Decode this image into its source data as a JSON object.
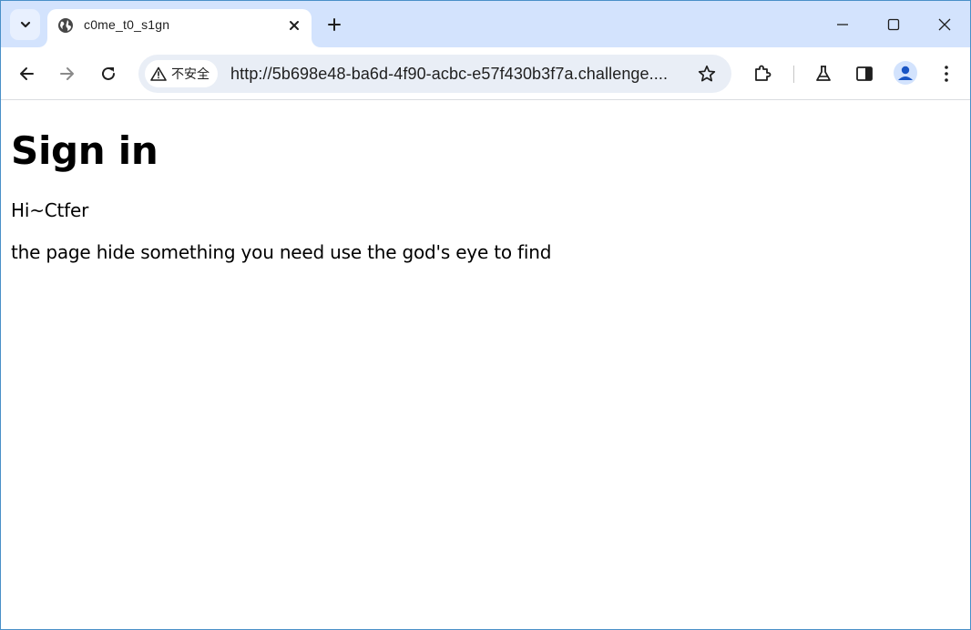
{
  "browser": {
    "tab": {
      "title": "c0me_t0_s1gn"
    },
    "address_bar": {
      "security_label": "不安全",
      "url": "http://5b698e48-ba6d-4f90-acbc-e57f430b3f7a.challenge...."
    },
    "icons": {
      "tab_search": "chevron-down-icon",
      "favicon": "globe-icon",
      "close": "close-icon",
      "new_tab": "plus-icon",
      "minimize": "minimize-icon",
      "maximize": "maximize-icon",
      "window_close": "close-icon",
      "back": "back-arrow-icon",
      "forward": "forward-arrow-icon",
      "reload": "reload-icon",
      "warning": "warning-icon",
      "bookmark": "star-icon",
      "extensions": "puzzle-icon",
      "labs": "flask-icon",
      "side_panel": "side-panel-icon",
      "profile": "profile-icon",
      "menu": "more-vert-icon"
    },
    "colors": {
      "tabstrip_bg": "#d3e3fd",
      "omnibox_bg": "#e9eef6",
      "profile_accent": "#1a56c4"
    }
  },
  "page": {
    "heading": "Sign in",
    "greeting": "Hi~Ctfer",
    "hint": "the page hide something you need use the god's eye to find"
  }
}
